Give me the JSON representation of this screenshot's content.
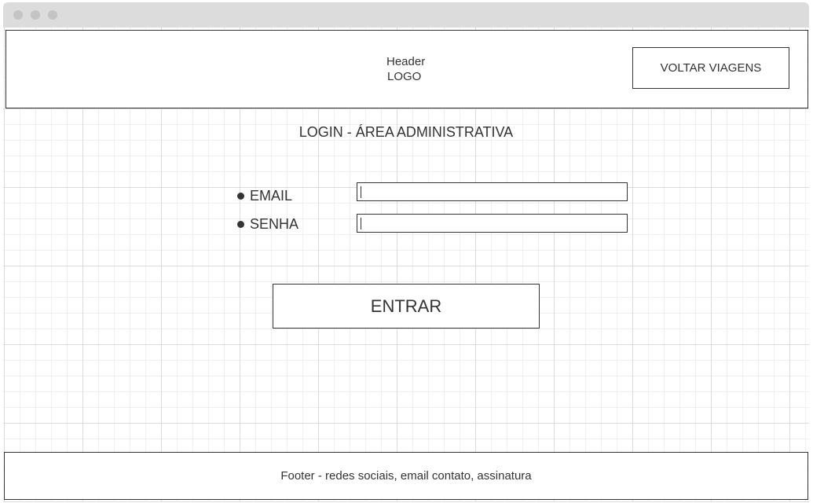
{
  "header": {
    "title": "Header",
    "logo": "LOGO",
    "back_button_label": "VOLTAR VIAGENS"
  },
  "login": {
    "title": "LOGIN - ÁREA ADMINISTRATIVA",
    "email_label": "EMAIL",
    "password_label": "SENHA",
    "email_value": "",
    "password_value": "",
    "submit_label": "ENTRAR"
  },
  "footer": {
    "text": "Footer - redes sociais, email contato, assinatura"
  },
  "colors": {
    "stroke": "#333333",
    "titlebar": "#dcdcdc",
    "grid": "#efefef"
  }
}
